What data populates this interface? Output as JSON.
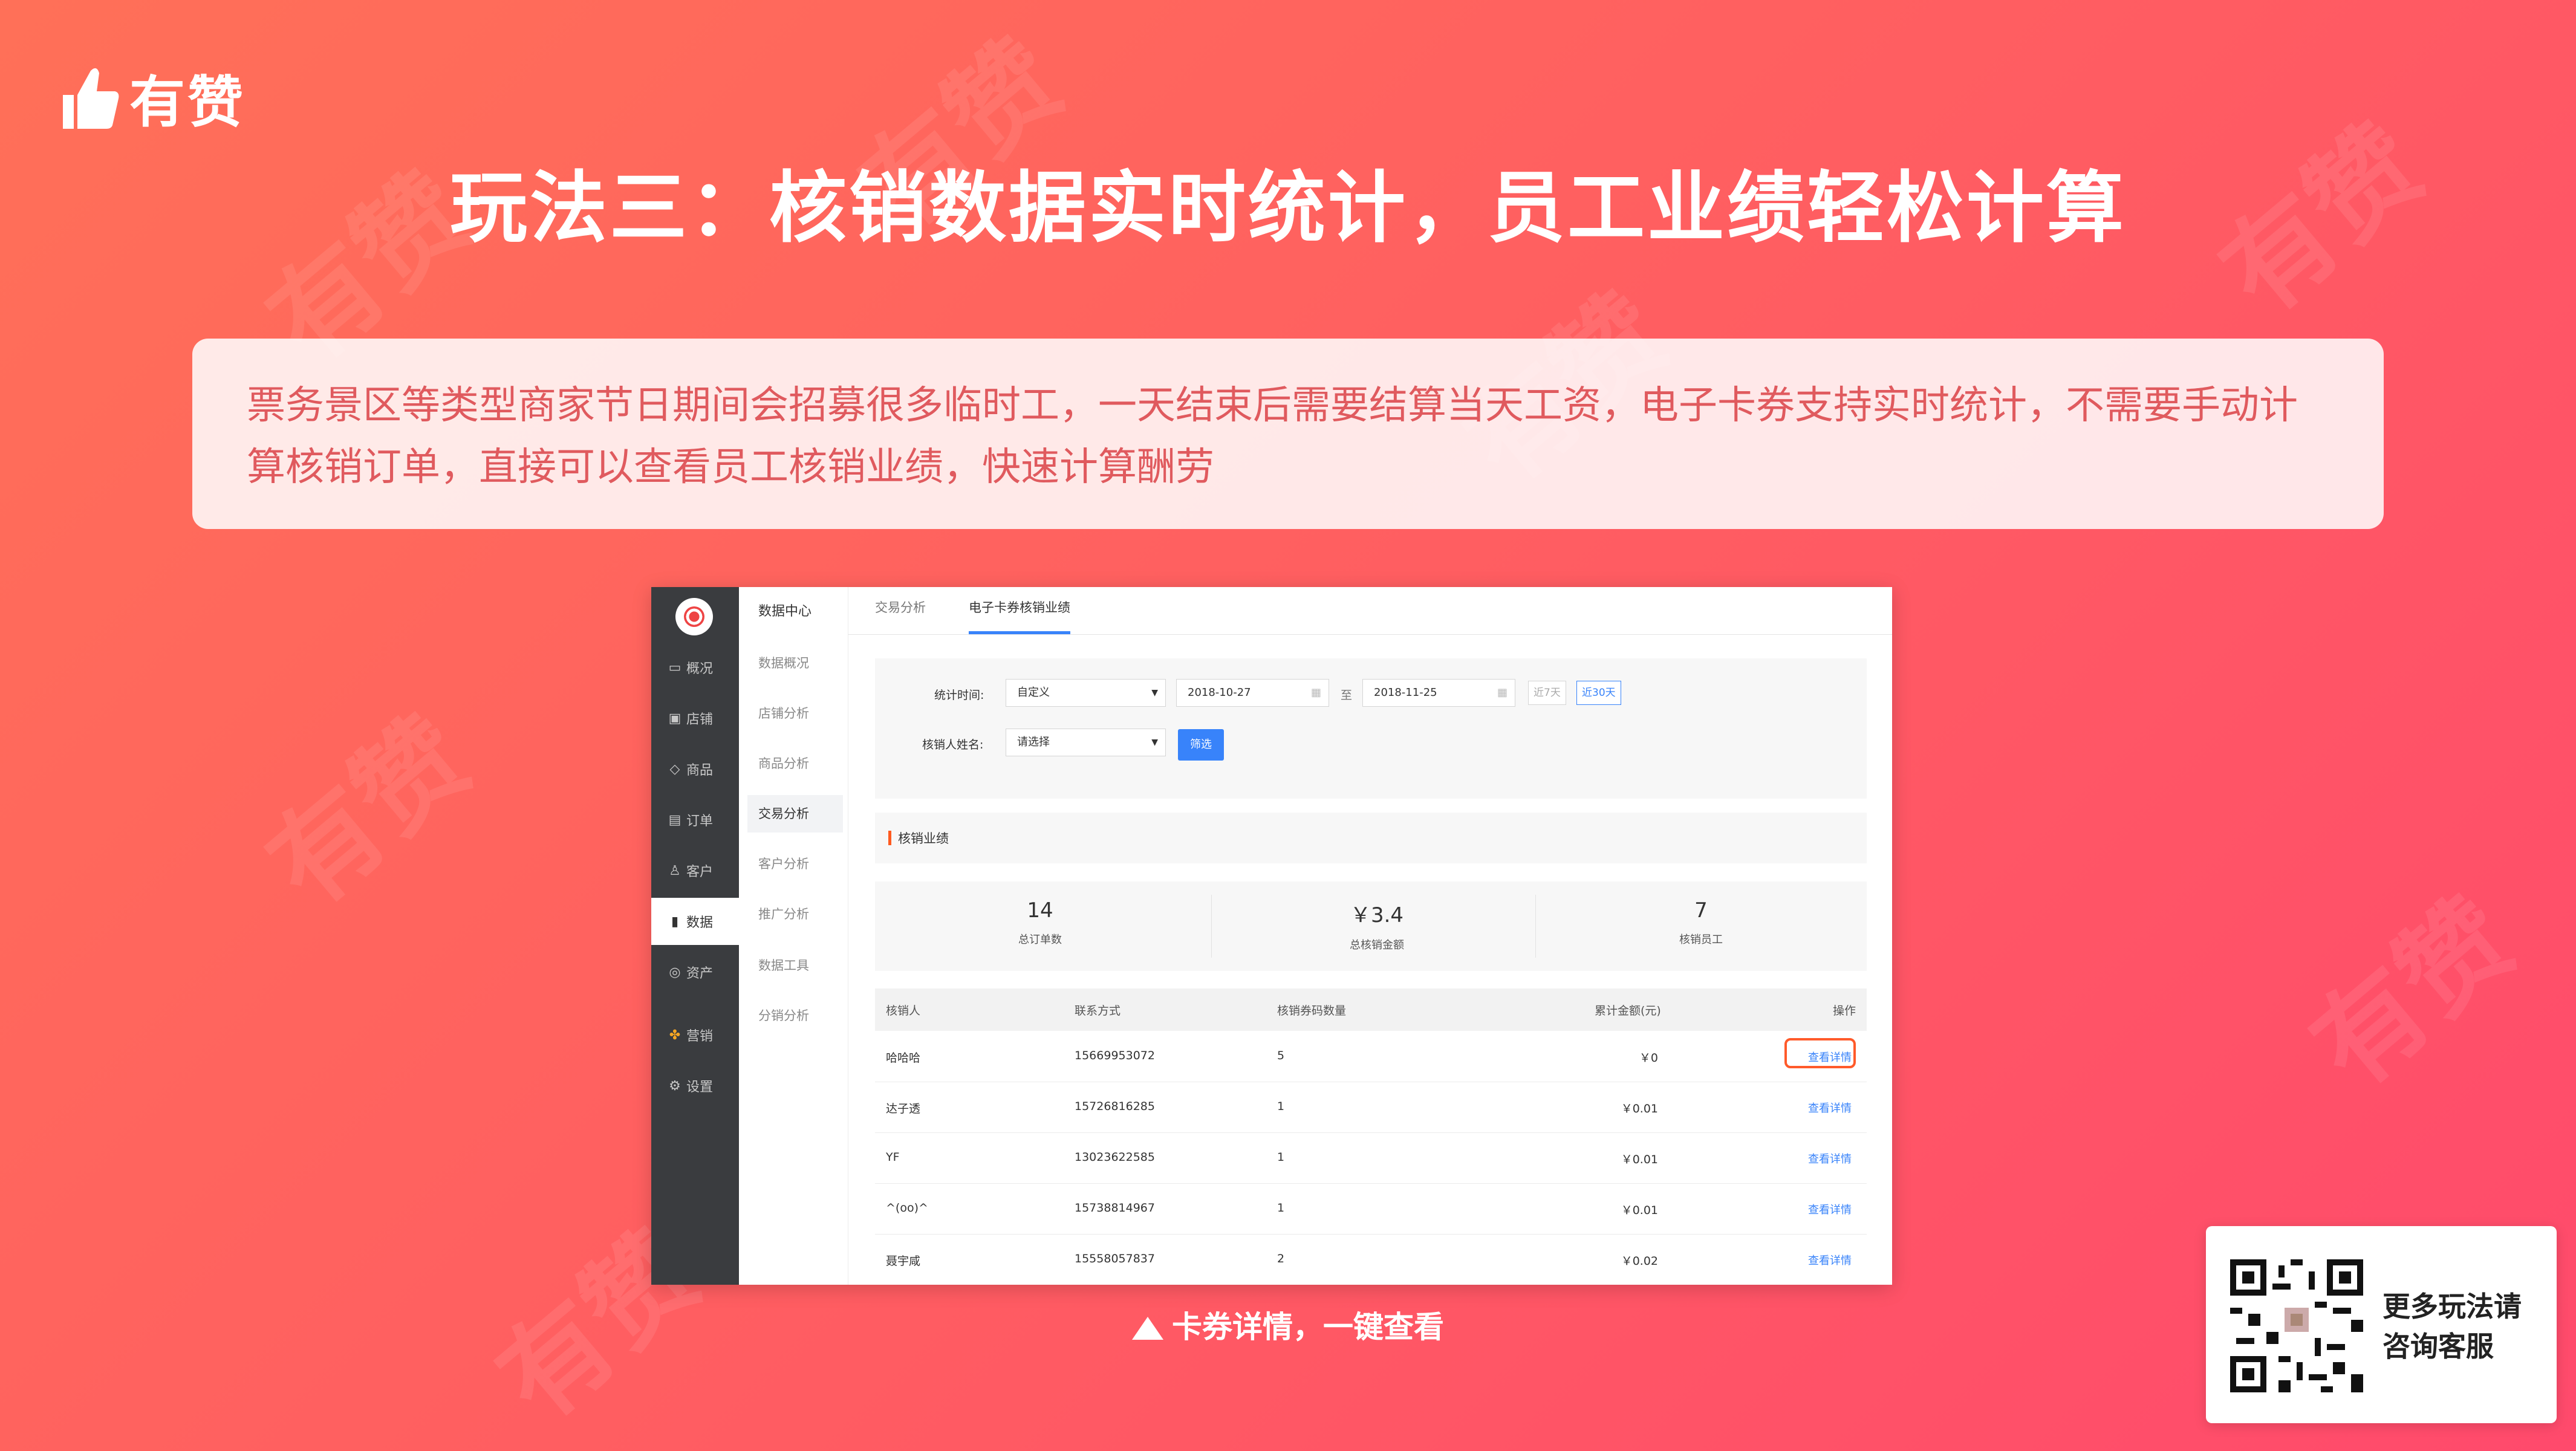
{
  "brand": {
    "name": "有赞",
    "watermark": "有赞"
  },
  "title": "玩法三：核销数据实时统计，员工业绩轻松计算",
  "description": "票务景区等类型商家节日期间会招募很多临时工，一天结束后需要结算当天工资，电子卡券支持实时统计，不需要手动计算核销订单，直接可以查看员工核销业绩，快速计算酬劳",
  "screenshot": {
    "sidebar": [
      {
        "icon": "monitor-icon",
        "label": "概况"
      },
      {
        "icon": "store-icon",
        "label": "店铺"
      },
      {
        "icon": "tag-icon",
        "label": "商品"
      },
      {
        "icon": "order-icon",
        "label": "订单"
      },
      {
        "icon": "user-icon",
        "label": "客户"
      },
      {
        "icon": "bar-chart-icon",
        "label": "数据"
      },
      {
        "icon": "asset-icon",
        "label": "资产"
      },
      {
        "icon": "grid-icon",
        "label": "营销"
      },
      {
        "icon": "gear-icon",
        "label": "设置"
      }
    ],
    "subnav": {
      "title": "数据中心",
      "items": [
        "数据概况",
        "店铺分析",
        "商品分析",
        "交易分析",
        "客户分析",
        "推广分析",
        "数据工具",
        "分销分析"
      ]
    },
    "tabs": [
      "交易分析",
      "电子卡券核销业绩"
    ],
    "filter": {
      "time_label": "统计时间:",
      "time_mode": "自定义",
      "start_date": "2018-10-27",
      "to": "至",
      "end_date": "2018-11-25",
      "chip_7": "近7天",
      "chip_30": "近30天",
      "name_label": "核销人姓名:",
      "name_placeholder": "请选择",
      "button": "筛选"
    },
    "section_title": "核销业绩",
    "stats": [
      {
        "value": "14",
        "label": "总订单数"
      },
      {
        "value": "￥3.4",
        "label": "总核销金额"
      },
      {
        "value": "7",
        "label": "核销员工"
      }
    ],
    "table": {
      "headers": [
        "核销人",
        "联系方式",
        "核销券码数量",
        "累计金额(元)",
        "操作"
      ],
      "rows": [
        {
          "name": "哈哈哈",
          "phone": "15669953072",
          "count": "5",
          "amount": "￥0",
          "action": "查看详情"
        },
        {
          "name": "达子透",
          "phone": "15726816285",
          "count": "1",
          "amount": "￥0.01",
          "action": "查看详情"
        },
        {
          "name": "YF",
          "phone": "13023622585",
          "count": "1",
          "amount": "￥0.01",
          "action": "查看详情"
        },
        {
          "name": "^(oo)^",
          "phone": "15738814967",
          "count": "1",
          "amount": "￥0.01",
          "action": "查看详情"
        },
        {
          "name": "聂宇咸",
          "phone": "15558057837",
          "count": "2",
          "amount": "￥0.02",
          "action": "查看详情"
        }
      ]
    }
  },
  "caption": "卡券详情，一键查看",
  "qr_card": {
    "line1": "更多玩法请",
    "line2": "咨询客服"
  }
}
